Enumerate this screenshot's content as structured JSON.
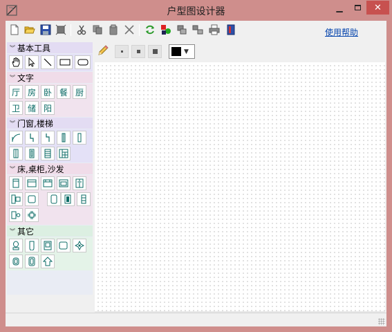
{
  "window": {
    "title": "户型图设计器"
  },
  "toolbar": {
    "help_label": "使用帮助"
  },
  "sidebar": {
    "sections": [
      {
        "title": "基本工具",
        "tools": [
          "hand-tool",
          "select-tool",
          "line-tool",
          "rectangle-tool",
          "rounded-rect-tool"
        ]
      },
      {
        "title": "文字",
        "tools": [
          "厅",
          "房",
          "卧",
          "餐",
          "厨",
          "卫",
          "储",
          "阳"
        ]
      },
      {
        "title": "门窗,楼梯",
        "tools": [
          "door-arc",
          "door-left",
          "door-right",
          "window-a",
          "window-b",
          "window-c",
          "window-d",
          "stair-a",
          "stair-b"
        ]
      },
      {
        "title": "床,桌柜,沙发",
        "tools": [
          "bed-a",
          "bed-b",
          "bed-c",
          "cabinet-a",
          "cabinet-b",
          "sofa-a",
          "table-a",
          "chair-a",
          "sofa-b",
          "sofa-c",
          "bed-d",
          "table-b"
        ]
      },
      {
        "title": "其它",
        "tools": [
          "toilet",
          "bathtub",
          "washer",
          "sink",
          "plant",
          "bottle-a",
          "bottle-b",
          "house"
        ]
      }
    ]
  },
  "canvas_toolbar": {
    "selected_color": "#000000"
  },
  "colors": {
    "titlebar": "#cf8e8c",
    "close_button": "#c7514f",
    "tool_icon": "#0b6b66",
    "link": "#0645ad"
  }
}
